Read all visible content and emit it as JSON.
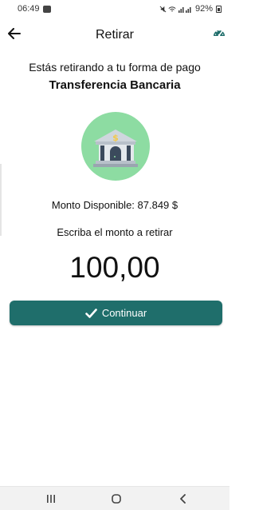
{
  "status_bar": {
    "time": "06:49",
    "signal": "⁺ᴵᴵᴵ",
    "battery": "92%"
  },
  "header": {
    "title": "Retirar",
    "back_icon": "arrow-left-icon",
    "right_icon": "speedometer-icon"
  },
  "main": {
    "intro": "Estás retirando a tu forma de pago",
    "method": "Transferencia Bancaria",
    "illustration_icon": "bank-icon",
    "available": "Monto Disponible: 87.849 $",
    "prompt": "Escriba el monto a retirar",
    "amount_value": "100,00",
    "continue_label": "Continuar"
  },
  "nav": {
    "recents_icon": "recents-icon",
    "home_icon": "home-icon",
    "back_icon": "back-icon"
  },
  "colors": {
    "accent": "#1f6e6b",
    "illustration_bg": "#8ddca2",
    "coin": "#f2c94c"
  }
}
